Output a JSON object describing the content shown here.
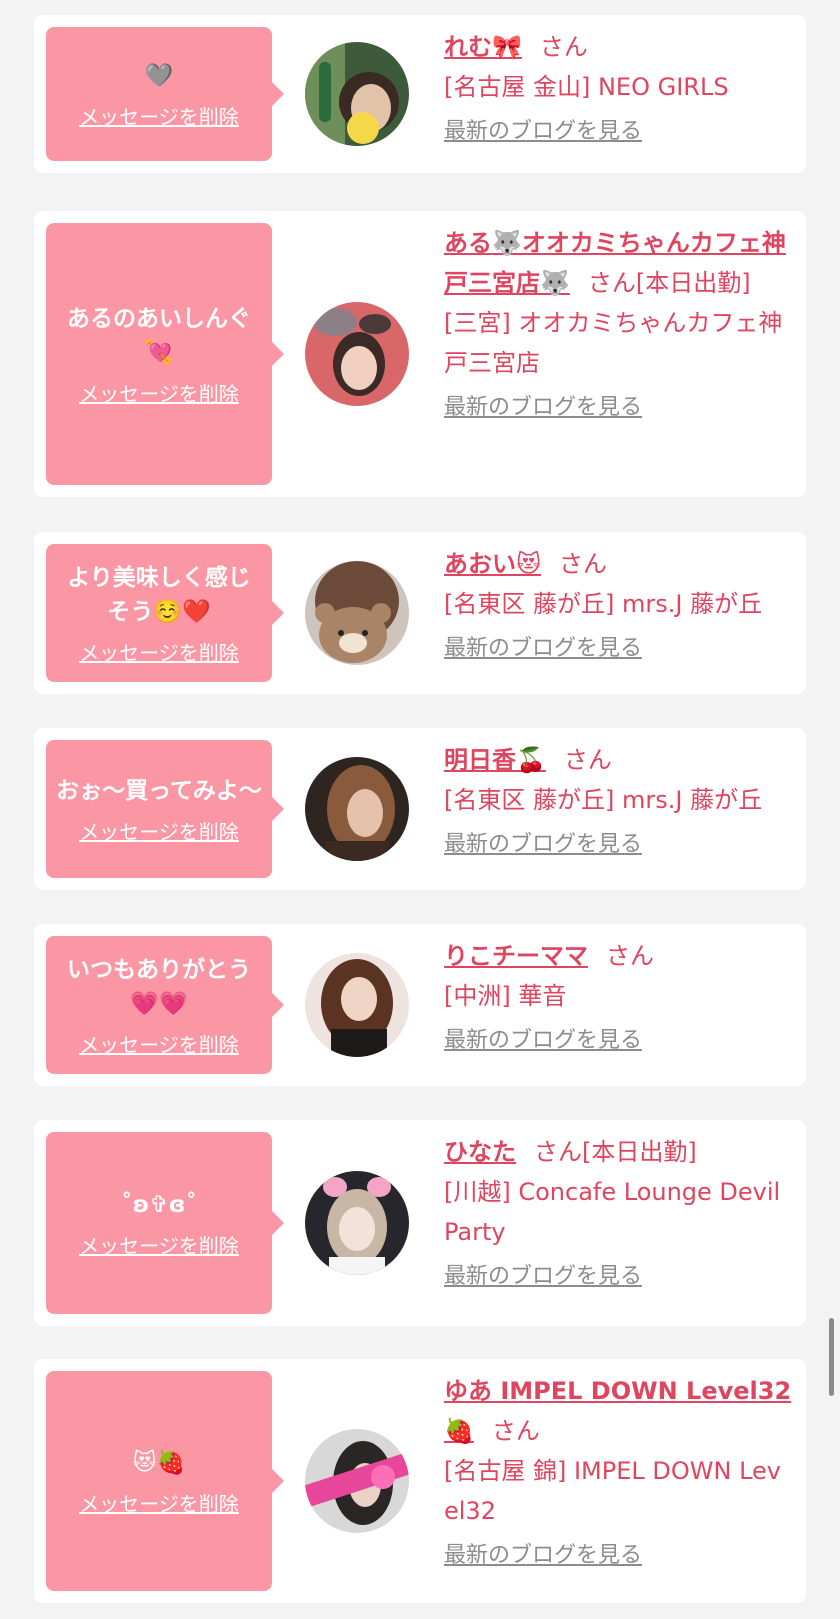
{
  "delete_label": "メッセージを削除",
  "blog_label": "最新のブログを見る",
  "honorific": "さん",
  "items": [
    {
      "message": "🩶",
      "name": "れむ🎀",
      "status": "",
      "shop": "[名古屋 金山] NEO GIRLS"
    },
    {
      "message": "あるのあいしんぐ💘",
      "name": "ある🐺オオカミちゃんカフェ神戸三宮店🐺",
      "status": "[本日出勤]",
      "shop": "[三宮] オオカミちゃんカフェ神戸三宮店"
    },
    {
      "message": "より美味しく感じそう☺️❤️",
      "name": "あおい😻",
      "status": "",
      "shop": "[名東区 藤が丘] mrs.J 藤が丘"
    },
    {
      "message": "おぉ～買ってみよ～",
      "name": "明日香🍒",
      "status": "",
      "shop": "[名東区 藤が丘] mrs.J 藤が丘"
    },
    {
      "message": "いつもありがとう💗💗",
      "name": "りこチーママ",
      "status": "",
      "shop": "[中洲] 華音"
    },
    {
      "message": "˚ʚ✞ɞ˚",
      "name": "ひなた",
      "status": "[本日出勤]",
      "shop": "[川越] Concafe Lounge Devil Party"
    },
    {
      "message": "😻🍓",
      "name": "ゆあ IMPEL DOWN Level32🍓",
      "status": "",
      "shop": "[名古屋 錦] IMPEL DOWN Level32"
    }
  ],
  "colors": {
    "page_bg": "#f3f3f3",
    "card_bg": "#ffffff",
    "bubble": "#fb97a5",
    "accent": "#e0455f",
    "link_gray": "#8c8c8c"
  }
}
